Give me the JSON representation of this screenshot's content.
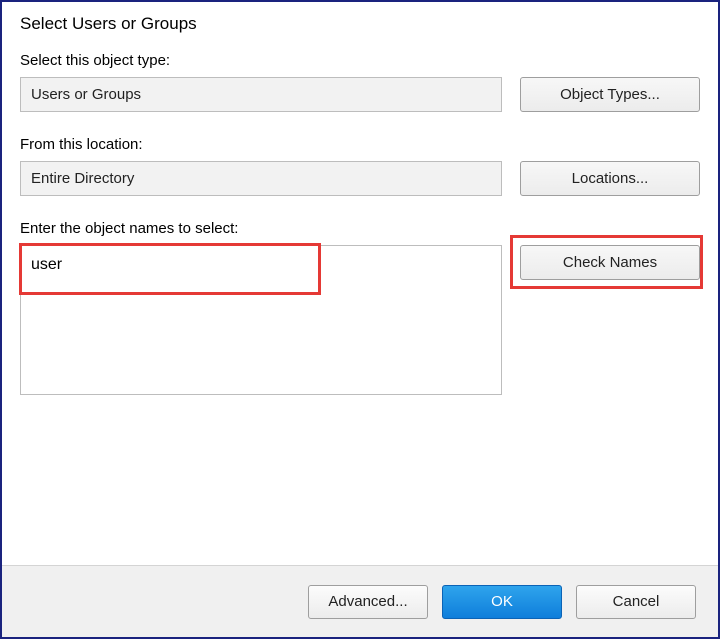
{
  "title": "Select Users or Groups",
  "object_type": {
    "label": "Select this object type:",
    "value": "Users or Groups",
    "button": "Object Types..."
  },
  "location": {
    "label": "From this location:",
    "value": "Entire Directory",
    "button": "Locations..."
  },
  "entry": {
    "label": "Enter the object names to select:",
    "value": "user",
    "button": "Check Names"
  },
  "footer": {
    "advanced": "Advanced...",
    "ok": "OK",
    "cancel": "Cancel"
  }
}
